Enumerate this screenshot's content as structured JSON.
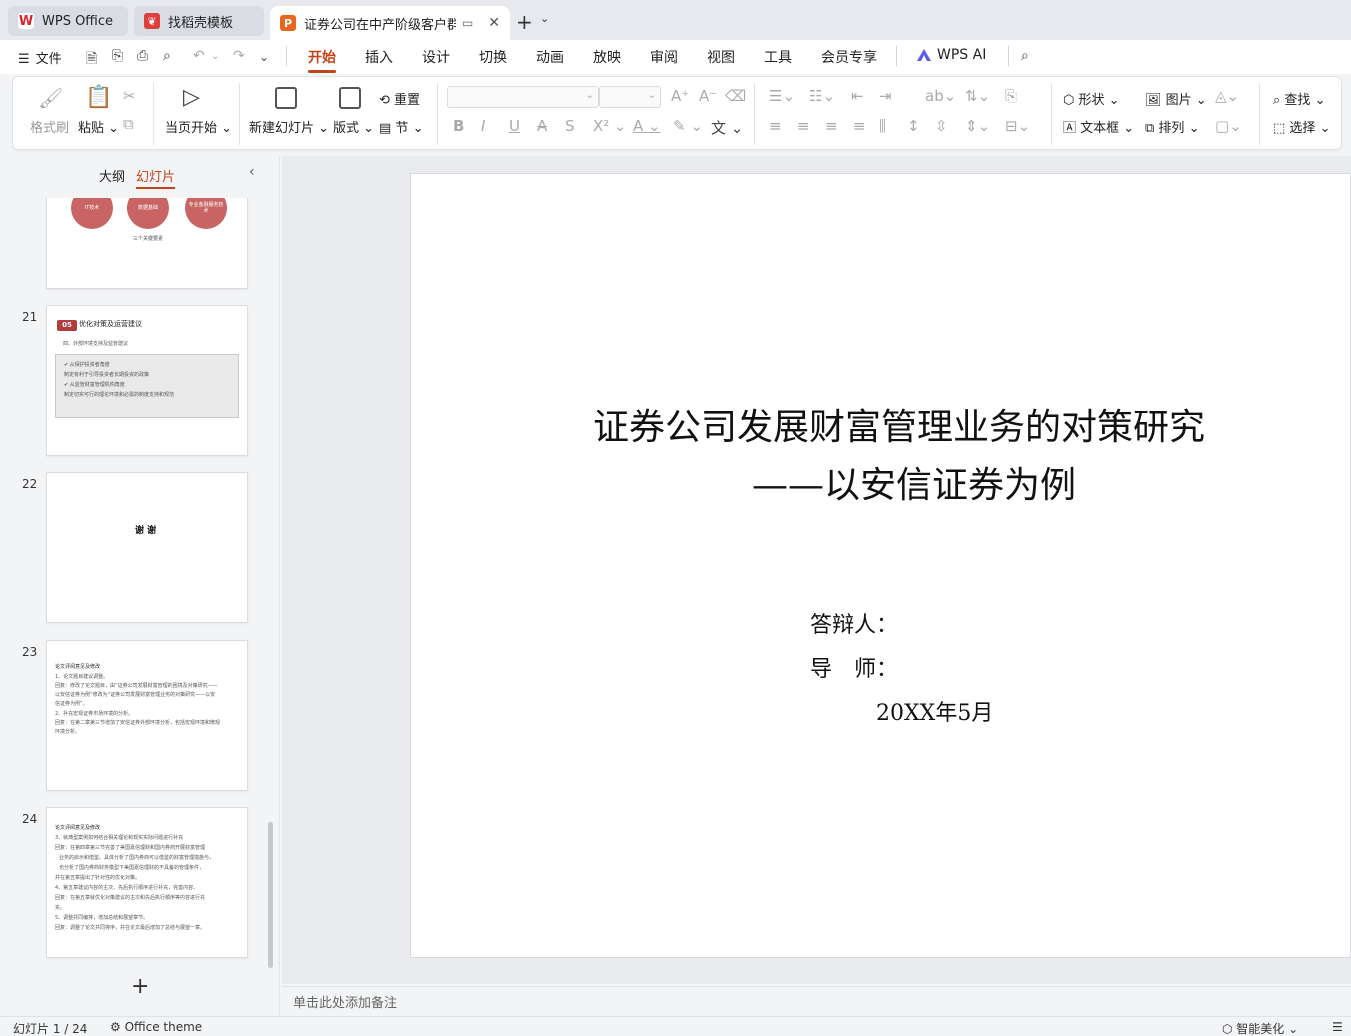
{
  "tabs": [
    {
      "label": "WPS Office",
      "icon": "wps-logo-icon"
    },
    {
      "label": "找稻壳模板",
      "icon": "daoke-icon"
    },
    {
      "label": "证券公司在中产阶级客户群发展",
      "icon": "presentation-icon"
    }
  ],
  "menu": {
    "file": "文件",
    "tabs": [
      "开始",
      "插入",
      "设计",
      "切换",
      "动画",
      "放映",
      "审阅",
      "视图",
      "工具",
      "会员专享",
      "WPS AI"
    ],
    "active": "开始"
  },
  "ribbon": {
    "format_painter": "格式刷",
    "paste": "粘贴",
    "start_from_current": "当页开始",
    "new_slide": "新建幻灯片",
    "layout": "版式",
    "reset": "重置",
    "section": "节",
    "shape": "形状",
    "picture": "图片",
    "textbox": "文本框",
    "arrange": "排列",
    "find": "查找",
    "select": "选择"
  },
  "panel": {
    "outline": "大纲",
    "slides": "幻灯片"
  },
  "thumbnails": {
    "t20": {
      "circles": [
        "IT技术",
        "数据基础",
        "专业金融服务技术"
      ],
      "caption": "三个关键要素"
    },
    "t21": {
      "number": "21",
      "badge": "05",
      "title": "优化对策及运营建议",
      "subtitle": "四、外部环境支持及监管建议",
      "lines": [
        "✔ 从保护投资者角度",
        "制定有利于引导投资者长期投资的政策",
        "✔ 从监管财富管理机构角度",
        "制定切实可行的理论环境和必需的制度支持和规范"
      ]
    },
    "t22": {
      "number": "22",
      "text": "谢 谢"
    },
    "t23": {
      "number": "23",
      "lines": [
        "论文评阅意见及修改",
        "1、论文题目建议调整。",
        "回复：修改了论文题目，由“证券公司发展财富管理的困境及对策研究——",
        "以安信证券为例”修改为“证券公司发展财富管理业务的对策研究——以安",
        "信证券为例”。",
        "2、补充宏观证券市场环境的分析。",
        "回复：在第二章第三节增加了安信证券外部环境分析，包括宏观环境和微观",
        "环境分析。"
      ]
    },
    "t24": {
      "number": "24",
      "lines": [
        "论文评阅意见及修改",
        "3、就典型案例如何结合相关理论和现实实际问题进行补充",
        "回复：在第四章第三节完善了美国嘉信理财和国内券商开展财富管理",
        "业务的启示和借鉴。具体分析了国内券商可以借鉴的财富管理措施与，",
        "也分析了国内券商财务模型下美国嘉信理财的不具备的管理条件，",
        "并在第五章提出了针对性的优化对策。",
        "4、第五章建议内容的主次、先后执行顺序进行补充，完善内容。",
        "回复：在第五章就优化对策建议的主次和先后执行顺序等内容进行充",
        "实。",
        "5、调整共同编排，增加总结和展望章节。",
        "回复：调整了论文共同排序，并在论文最后增加了总结与展望一章。"
      ]
    }
  },
  "slide": {
    "title_line1": "证券公司发展财富管理业务的对策研究",
    "title_line2": "——以安信证券为例",
    "defender": "答辩人：",
    "advisor": "导　师：",
    "date": "20XX年5月"
  },
  "notes_placeholder": "单击此处添加备注",
  "status": {
    "slide_counter": "幻灯片 1 / 24",
    "theme": "Office theme",
    "beautify": "智能美化"
  },
  "colors": {
    "accent": "#c4441a",
    "thumb_circle": "#c86464",
    "badge": "#b23b3b"
  }
}
